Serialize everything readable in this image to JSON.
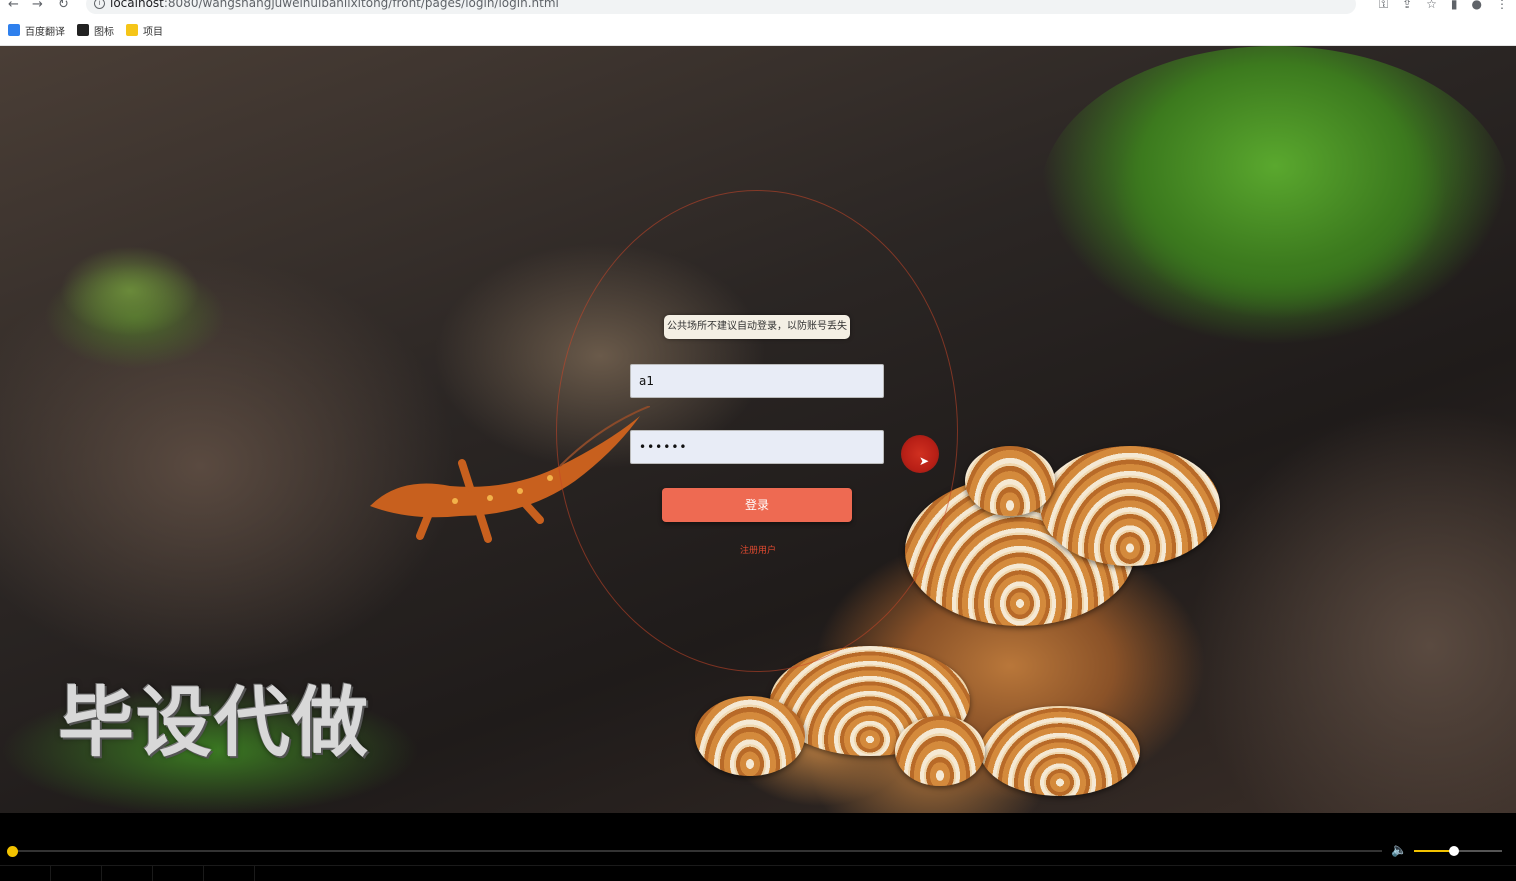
{
  "browser": {
    "url_host": "localhost",
    "url_path": ":8080/wangshangjuweihuibanlixitong/front/pages/login/login.html",
    "bookmarks": [
      {
        "label": "百度翻译",
        "icon": "translate-icon",
        "color": "#2f80ed"
      },
      {
        "label": "图标",
        "icon": "image-icon",
        "color": "#222222"
      },
      {
        "label": "项目",
        "icon": "folder-icon",
        "color": "#f5c518"
      }
    ]
  },
  "login": {
    "tooltip": "公共场所不建议自动登录，以防账号丢失",
    "username_value": "a1",
    "password_value": "••••••",
    "login_label": "登录",
    "register_label": "注册用户"
  },
  "overlay": {
    "watermark": "毕设代做"
  },
  "player": {
    "progress": 0.0,
    "volume": 0.45,
    "accent_color": "#f2c200"
  }
}
